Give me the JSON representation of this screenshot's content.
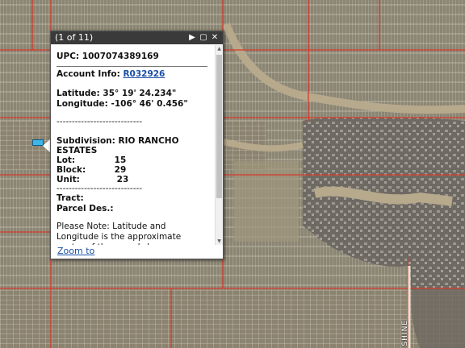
{
  "popup": {
    "counter": "(1 of 11)",
    "upc_label": "UPC:",
    "upc_value": "1007074389169",
    "account_label": "Account Info:",
    "account_value": "R032926",
    "latitude_label": "Latitude:",
    "latitude_value": "35° 19' 24.234\"",
    "longitude_label": "Longitude:",
    "longitude_value": "-106° 46' 0.456\"",
    "separator": "----------------------------",
    "subdivision_label": "Subdivision:",
    "subdivision_value_line1": "RIO RANCHO",
    "subdivision_value_line2": "ESTATES",
    "lot_label": "Lot:",
    "lot_value": "15",
    "block_label": "Block:",
    "block_value": "29",
    "unit_label": "Unit:",
    "unit_value": "23",
    "tract_label": "Tract:",
    "parcel_label": "Parcel Des.:",
    "note": "Please Note: Latitude and Longitude is the approximate center of the parcel shown.",
    "zoom_link": "Zoom to"
  },
  "map": {
    "street_label": "SHINE",
    "colors": {
      "parcel_lines": "#c8c2b4",
      "boundary": "#d83a2a",
      "terrain": "#8f8670"
    }
  }
}
